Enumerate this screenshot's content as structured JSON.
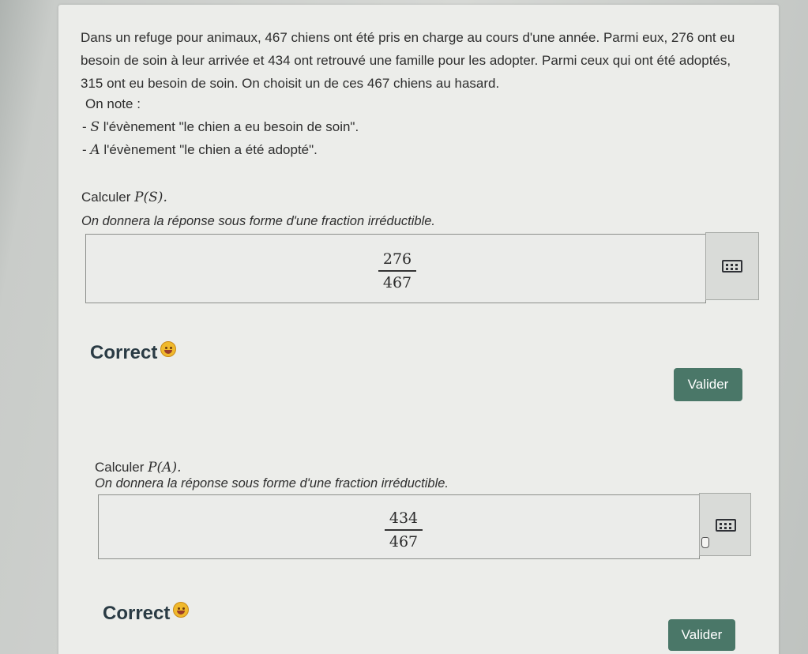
{
  "problem": {
    "line1": "Dans un refuge pour animaux, 467 chiens ont été pris en charge au cours d'une année. Parmi eux, 276 ont eu",
    "line2": "besoin de soin à leur arrivée et 434 ont retrouvé une famille pour les adopter. Parmi ceux qui ont été adoptés,",
    "line3": "315 ont eu besoin de soin. On choisit un de ces 467 chiens au hasard.",
    "on_note": "On note :",
    "bullet1_prefix": "- ",
    "bullet1_var": "S",
    "bullet1_text": " l'évènement \"le chien a eu besoin de soin\".",
    "bullet2_prefix": "- ",
    "bullet2_var": "A",
    "bullet2_text": " l'évènement \"le chien a été adopté\"."
  },
  "question1": {
    "prompt_prefix": "Calculer ",
    "prompt_math": "P(S).",
    "instruction": "On donnera la réponse sous forme d'une fraction irréductible.",
    "answer_numerator": "276",
    "answer_denominator": "467",
    "keyboard_icon": "keyboard-icon",
    "feedback": "Correct",
    "feedback_icon": "smiley-icon",
    "submit_label": "Valider"
  },
  "question2": {
    "prompt_prefix": "Calculer ",
    "prompt_math": "P(A).",
    "instruction": "On donnera la réponse sous forme d'une fraction irréductible.",
    "answer_numerator": "434",
    "answer_denominator": "467",
    "keyboard_icon": "keyboard-icon",
    "feedback": "Correct",
    "feedback_icon": "smiley-icon",
    "submit_label": "Valider"
  },
  "colors": {
    "button": "#4a7768",
    "correct_text": "#2a3b44",
    "card": "#ecedea"
  }
}
